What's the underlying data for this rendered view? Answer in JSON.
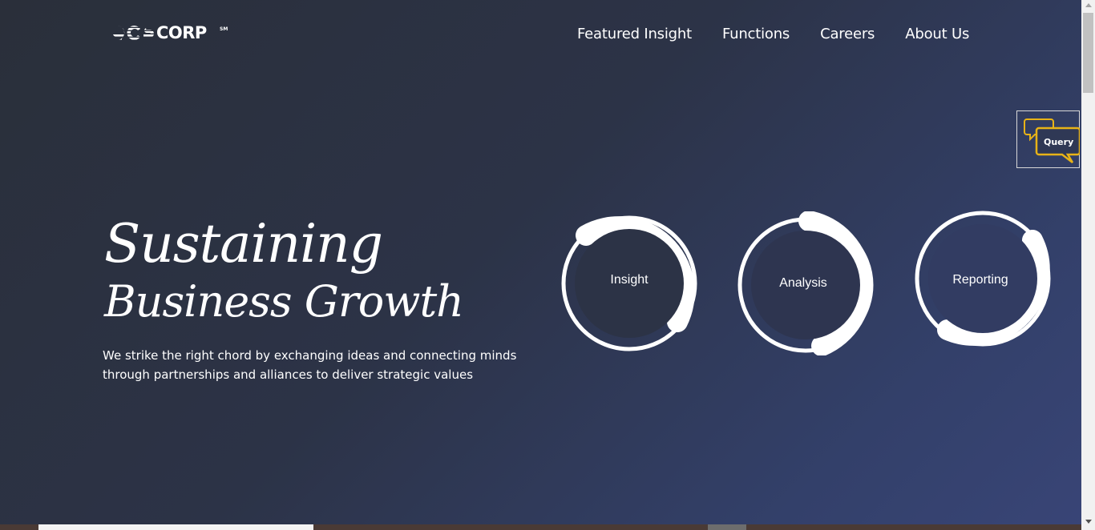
{
  "logo": {
    "text": "ecscorp",
    "mark": "SM"
  },
  "nav": {
    "items": [
      {
        "label": "Featured Insight"
      },
      {
        "label": "Functions"
      },
      {
        "label": "Careers"
      },
      {
        "label": "About Us"
      }
    ]
  },
  "query_widget": {
    "label": "Query",
    "icon": "chat-bubbles-icon",
    "accent": "#e8b317"
  },
  "hero": {
    "headline_line1": "Sustaining",
    "headline_line2": "Business Growth",
    "tagline": "We strike the right chord by exchanging ideas and connecting minds through partnerships and alliances to deliver strategic values"
  },
  "rings": [
    {
      "label": "Insight"
    },
    {
      "label": "Analysis"
    },
    {
      "label": "Reporting"
    }
  ],
  "colors": {
    "bg_start": "#2a2f3a",
    "bg_end": "#394577",
    "text": "#ffffff"
  }
}
